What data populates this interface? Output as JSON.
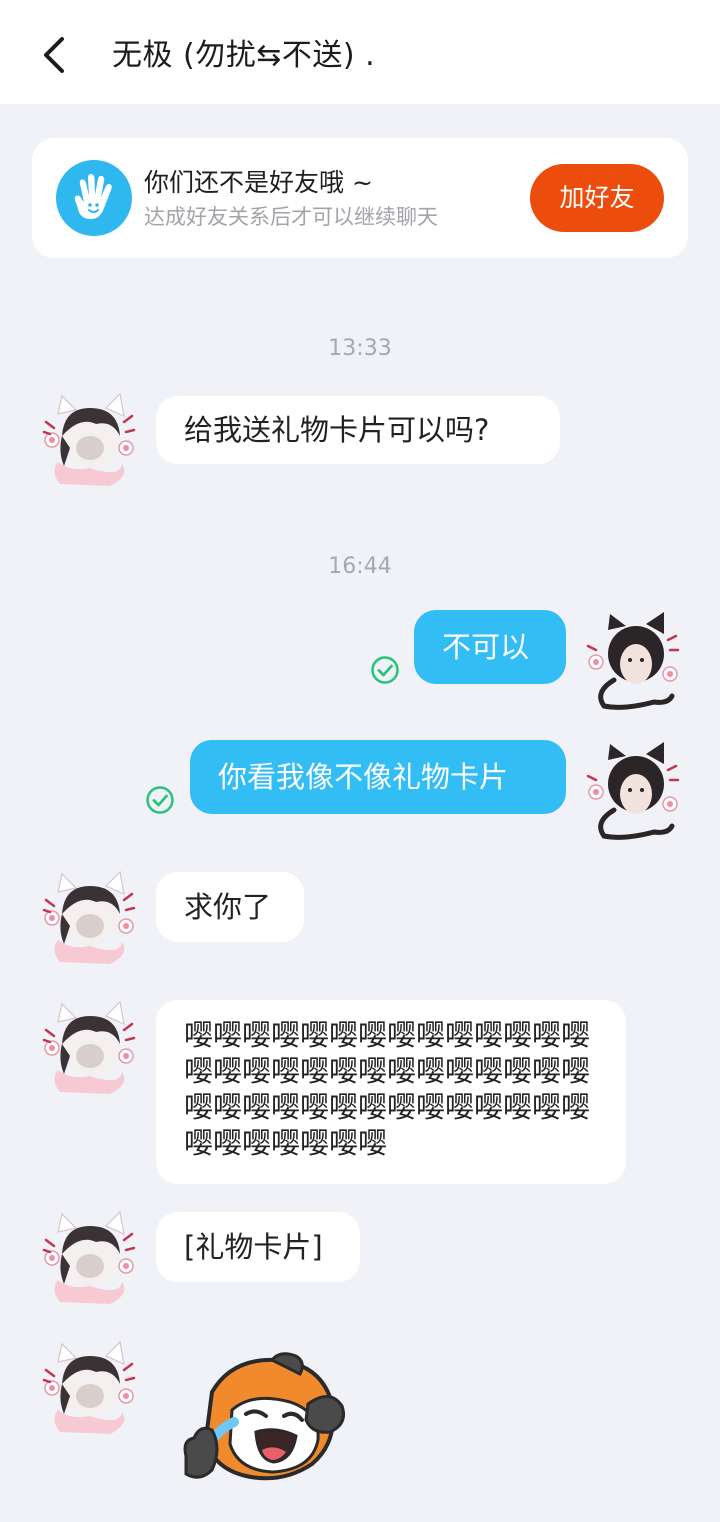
{
  "header": {
    "back_icon": "chevron-left-icon",
    "title": "无极 (勿扰⇆不送) ."
  },
  "banner": {
    "icon": "waving-hand-icon",
    "title": "你们还不是好友哦 ~",
    "subtitle": "达成好友关系后才可以继续聊天",
    "add_button": "加好友"
  },
  "colors": {
    "accent_orange": "#ed4d0c",
    "outgoing_bubble": "#32bdf5",
    "read_check": "#27c37b",
    "banner_icon_bg": "#2fb8ef"
  },
  "messages": [
    {
      "type": "time",
      "text": "13:33"
    },
    {
      "type": "incoming",
      "text": "给我送礼物卡片可以吗?"
    },
    {
      "type": "time",
      "text": "16:44"
    },
    {
      "type": "outgoing",
      "text": "不可以",
      "status_icon": "read-check-icon"
    },
    {
      "type": "outgoing",
      "text": "你看我像不像礼物卡片",
      "status_icon": "read-check-icon"
    },
    {
      "type": "incoming",
      "text": "求你了"
    },
    {
      "type": "incoming",
      "text": "嘤嘤嘤嘤嘤嘤嘤嘤嘤嘤嘤嘤嘤嘤嘤嘤嘤嘤嘤嘤嘤嘤嘤嘤嘤嘤嘤嘤嘤嘤嘤嘤嘤嘤嘤嘤嘤嘤嘤嘤嘤嘤嘤嘤嘤嘤嘤嘤嘤"
    },
    {
      "type": "incoming",
      "text": "[礼物卡片]"
    },
    {
      "type": "incoming_sticker",
      "sticker": "crying-panda-sticker"
    }
  ]
}
